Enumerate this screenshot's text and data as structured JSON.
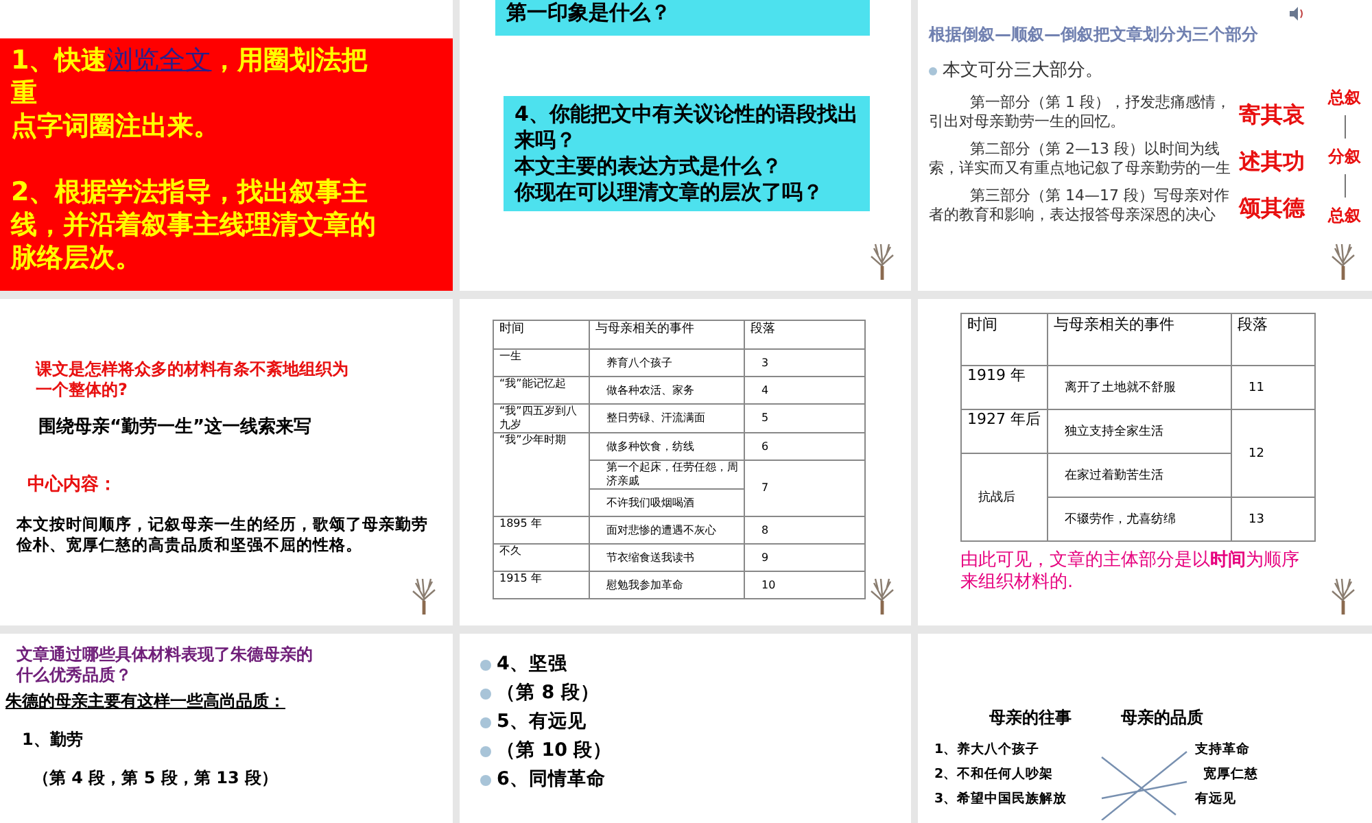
{
  "slides": [
    {
      "kind": "red_box",
      "paragraphs": [
        {
          "before": "1、快速",
          "link": "浏览全文",
          "after": "，用圈划法把重"
        },
        {
          "before": "点字词圈注出来。"
        },
        {
          "before": "2、根据学法指导，找出叙事主线，并沿着叙事主线理清文章的脉络层次。"
        }
      ]
    },
    {
      "kind": "cyan_boxes",
      "boxes": [
        {
          "lines": [
            "第一印象是什么？"
          ]
        },
        {
          "lines": [
            "4、你能把文中有关议论性的语段找出来吗？",
            "本文主要的表达方式是什么？",
            "你现在可以理清文章的层次了吗？"
          ]
        }
      ]
    },
    {
      "kind": "outline",
      "heading": "根据**倒叙—顺叙—倒叙**把文章划分为三个部分",
      "bullet": "本文可分三大部分。",
      "parts": [
        {
          "text": "第一部分（第 1 段），抒发悲痛感情，引出对母亲勤劳一生的回忆。",
          "tag": "寄其哀"
        },
        {
          "text": "第二部分（第 2—13 段）以时间为线索，详实而又有重点地记叙了母亲勤劳的一生",
          "tag": "述其功"
        },
        {
          "text": "第三部分（第 14—17 段）写母亲对作者的教育和影响，表达报答母亲深恩的决心",
          "tag": "颂其德"
        }
      ],
      "side_labels": [
        "总叙",
        "分叙",
        "总叙"
      ]
    },
    {
      "kind": "summary",
      "question": "课文是怎样将众多的材料有条不紊地组织为一个整体的?",
      "answer": "围绕母亲“勤劳一生”这一线索来写",
      "label": "中心内容：",
      "body": "本文按时间顺序，记叙母亲一生的经历，歌颂了母亲勤劳俭朴、宽厚仁慈的高贵品质和坚强不屈的性格。"
    },
    {
      "kind": "table",
      "columns": [
        "时间",
        "与母亲相关的事件",
        "段落"
      ],
      "rows": [
        [
          {
            "text": "一生"
          },
          {
            "text": "养育八个孩子"
          },
          {
            "text": "3"
          }
        ],
        [
          {
            "text": "“我”能记忆起"
          },
          {
            "text": "做各种农活、家务"
          },
          {
            "text": "4"
          }
        ],
        [
          {
            "text": "“我”四五岁到八九岁"
          },
          {
            "text": "整日劳碌、汗流满面"
          },
          {
            "text": "5"
          }
        ],
        [
          {
            "text": "“我”少年时期",
            "rowspan": 3
          },
          {
            "text": "做多种饮食，纺线"
          },
          {
            "text": "6"
          }
        ],
        [
          {
            "text": "第一个起床，任劳任怨，周济亲戚"
          },
          {
            "text": "7",
            "rowspan": 2
          }
        ],
        [
          {
            "text": "不许我们吸烟喝酒"
          }
        ],
        [
          {
            "text": "1895 年"
          },
          {
            "text": "面对悲惨的遭遇不灰心"
          },
          {
            "text": "8"
          }
        ],
        [
          {
            "text": "不久"
          },
          {
            "text": "节衣缩食送我读书"
          },
          {
            "text": "9"
          }
        ],
        [
          {
            "text": "1915 年"
          },
          {
            "text": "慰勉我参加革命"
          },
          {
            "text": "10"
          }
        ]
      ]
    },
    {
      "kind": "table",
      "columns": [
        "时间",
        "与母亲相关的事件",
        "段落"
      ],
      "rows": [
        [
          {
            "text": "1919 年"
          },
          {
            "text": "离开了土地就不舒服"
          },
          {
            "text": "11"
          }
        ],
        [
          {
            "text": "1927 年后"
          },
          {
            "text": "独立支持全家生活"
          },
          {
            "text": "12",
            "rowspan": 2
          }
        ],
        [
          {
            "text": "抗战后",
            "rowspan": 2
          },
          {
            "text": "在家过着勤苦生活"
          }
        ],
        [
          {
            "text": "不辍劳作，尤喜纺绵"
          },
          {
            "text": "13"
          }
        ]
      ],
      "caption": "由此可见，文章的主体部分是以**时间**为顺序来组织材料的."
    },
    {
      "kind": "qualities",
      "title": "文章通过哪些具体材料表现了朱德母亲的什么优秀品质？",
      "subtitle": "朱德的母亲主要有这样一些高尚品质：",
      "items": [
        "1、勤劳",
        "（第 4 段，第 5 段，第 13 段）"
      ]
    },
    {
      "kind": "bullets",
      "items": [
        "4、坚强",
        "（第 8 段）",
        "5、有远见",
        "（第 10 段）",
        "6、同情革命"
      ]
    },
    {
      "kind": "matching",
      "left_title": "母亲的往事",
      "right_title": "母亲的品质",
      "left": [
        "1、养大八个孩子",
        "2、不和任何人吵架",
        "3、希望中国民族解放"
      ],
      "right": [
        "支持革命",
        "宽厚仁慈",
        "有远见"
      ]
    }
  ]
}
